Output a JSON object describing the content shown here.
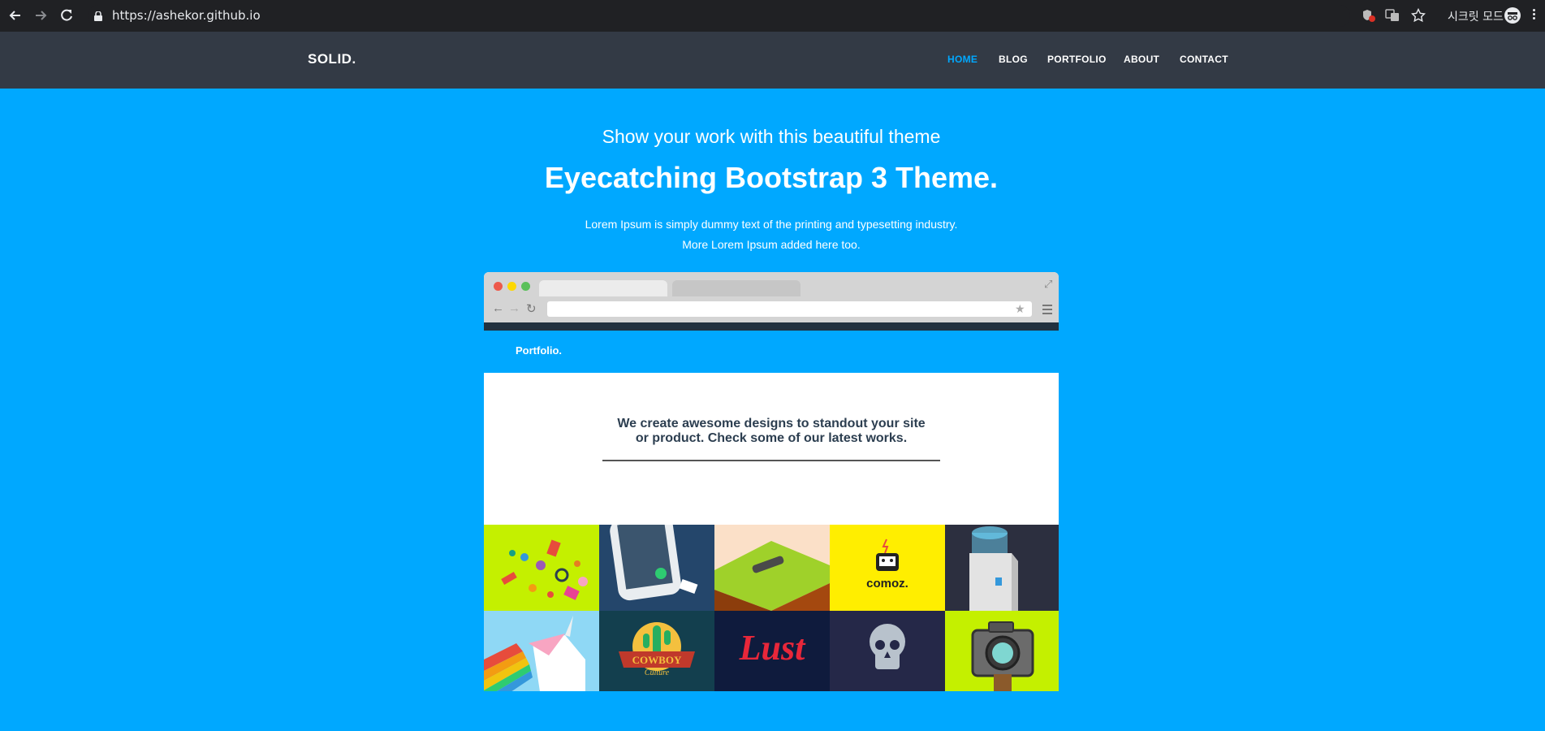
{
  "browser": {
    "url": "https://ashekor.github.io",
    "incognito_label": "시크릿 모드",
    "icons": [
      "back-icon",
      "forward-icon",
      "reload-icon",
      "lock-icon",
      "shield-icon",
      "translate-icon",
      "star-icon",
      "incognito-icon",
      "kebab-menu-icon"
    ]
  },
  "site": {
    "brand": "SOLID.",
    "nav": [
      {
        "label": "HOME",
        "active": true
      },
      {
        "label": "BLOG",
        "active": false
      },
      {
        "label": "PORTFOLIO",
        "active": false
      },
      {
        "label": "ABOUT",
        "active": false
      },
      {
        "label": "CONTACT",
        "active": false
      }
    ],
    "colors": {
      "accent": "#00a8ff",
      "navbar": "#333a45",
      "active_link": "#00a8ff"
    }
  },
  "hero": {
    "subtitle": "Show your work with this beautiful theme",
    "title": "Eyecatching Bootstrap 3 Theme.",
    "line1": "Lorem Ipsum is simply dummy text of the printing and typesetting industry.",
    "line2": "More Lorem Ipsum added here too."
  },
  "mockup": {
    "brand": "Portfolio.",
    "tagline_1": "We create awesome designs to standout your site",
    "tagline_2": "or product. Check some of our latest works.",
    "tiles": [
      {
        "name": "candy-tile",
        "bg": "#c4f000"
      },
      {
        "name": "phone-tile",
        "bg": "#24466b"
      },
      {
        "name": "hammock-tile",
        "bg": "#fbe0c8"
      },
      {
        "name": "comoz-tile",
        "bg": "#ffee00",
        "text": "comoz."
      },
      {
        "name": "water-cooler-tile",
        "bg": "#2c2f3f"
      },
      {
        "name": "unicorn-tile",
        "bg": "#8fd8f5"
      },
      {
        "name": "cowboy-tile",
        "bg": "#133f4e",
        "text": "COWBOY",
        "subtext": "Culture"
      },
      {
        "name": "lust-tile",
        "bg": "#0f1b3d",
        "text": "Lust"
      },
      {
        "name": "skull-tile",
        "bg": "#252848"
      },
      {
        "name": "camera-tile",
        "bg": "#c4f000"
      }
    ]
  }
}
